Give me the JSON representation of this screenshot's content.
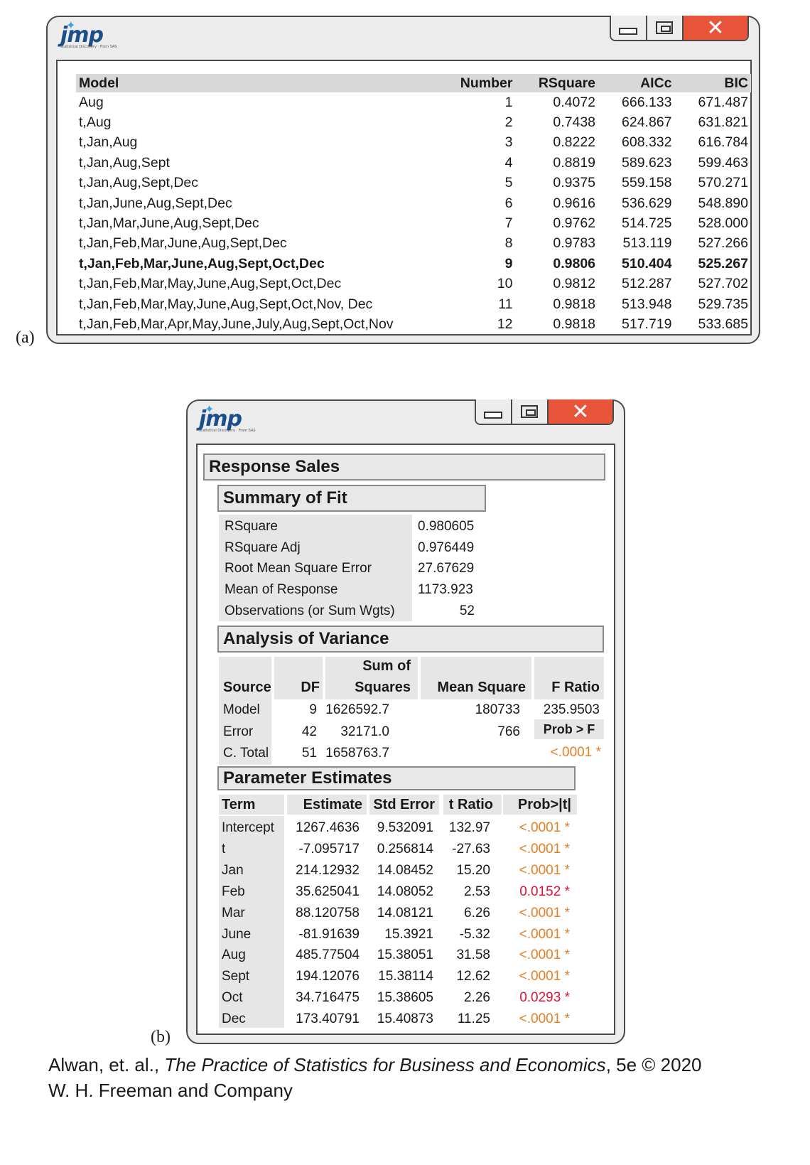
{
  "window_a": {
    "logo": "jmp",
    "caption": "(a)",
    "columns": [
      "Model",
      "Number",
      "RSquare",
      "AICc",
      "BIC"
    ],
    "rows": [
      {
        "model": "Aug",
        "number": "1",
        "rsquare": "0.4072",
        "aicc": "666.133",
        "bic": "671.487"
      },
      {
        "model": "t,Aug",
        "number": "2",
        "rsquare": "0.7438",
        "aicc": "624.867",
        "bic": "631.821"
      },
      {
        "model": "t,Jan,Aug",
        "number": "3",
        "rsquare": "0.8222",
        "aicc": "608.332",
        "bic": "616.784"
      },
      {
        "model": "t,Jan,Aug,Sept",
        "number": "4",
        "rsquare": "0.8819",
        "aicc": "589.623",
        "bic": "599.463"
      },
      {
        "model": "t,Jan,Aug,Sept,Dec",
        "number": "5",
        "rsquare": "0.9375",
        "aicc": "559.158",
        "bic": "570.271"
      },
      {
        "model": "t,Jan,June,Aug,Sept,Dec",
        "number": "6",
        "rsquare": "0.9616",
        "aicc": "536.629",
        "bic": "548.890"
      },
      {
        "model": "t,Jan,Mar,June,Aug,Sept,Dec",
        "number": "7",
        "rsquare": "0.9762",
        "aicc": "514.725",
        "bic": "528.000"
      },
      {
        "model": "t,Jan,Feb,Mar,June,Aug,Sept,Dec",
        "number": "8",
        "rsquare": "0.9783",
        "aicc": "513.119",
        "bic": "527.266"
      },
      {
        "model": "t,Jan,Feb,Mar,June,Aug,Sept,Oct,Dec",
        "number": "9",
        "rsquare": "0.9806",
        "aicc": "510.404",
        "bic": "525.267",
        "highlight": true
      },
      {
        "model": "t,Jan,Feb,Mar,May,June,Aug,Sept,Oct,Dec",
        "number": "10",
        "rsquare": "0.9812",
        "aicc": "512.287",
        "bic": "527.702"
      },
      {
        "model": "t,Jan,Feb,Mar,May,June,Aug,Sept,Oct,Nov, Dec",
        "number": "11",
        "rsquare": "0.9818",
        "aicc": "513.948",
        "bic": "529.735"
      },
      {
        "model": "t,Jan,Feb,Mar,Apr,May,June,July,Aug,Sept,Oct,Nov",
        "number": "12",
        "rsquare": "0.9818",
        "aicc": "517.719",
        "bic": "533.685"
      }
    ]
  },
  "window_b": {
    "logo": "jmp",
    "caption": "(b)",
    "response_title": "Response Sales",
    "summary": {
      "title": "Summary of Fit",
      "rows": [
        {
          "label": "RSquare",
          "value": "0.980605"
        },
        {
          "label": "RSquare Adj",
          "value": "0.976449"
        },
        {
          "label": "Root Mean Square Error",
          "value": "27.67629"
        },
        {
          "label": "Mean of Response",
          "value": "1173.923"
        },
        {
          "label": "Observations (or Sum Wgts)",
          "value": "52"
        }
      ]
    },
    "anova": {
      "title": "Analysis of Variance",
      "headers": {
        "source": "Source",
        "df": "DF",
        "ss_top": "Sum of",
        "ss_bottom": "Squares",
        "ms": "Mean Square",
        "f": "F Ratio",
        "prob": "Prob > F"
      },
      "rows": [
        {
          "source": "Model",
          "df": "9",
          "ss": "1626592.7",
          "ms": "180733",
          "f": "235.9503"
        },
        {
          "source": "Error",
          "df": "42",
          "ss": "32171.0",
          "ms": "766",
          "f": ""
        },
        {
          "source": "C. Total",
          "df": "51",
          "ss": "1658763.7",
          "ms": "",
          "f": ""
        }
      ],
      "prob_value": "<.0001 *"
    },
    "params": {
      "title": "Parameter Estimates",
      "headers": {
        "term": "Term",
        "estimate": "Estimate",
        "stderr": "Std Error",
        "tratio": "t Ratio",
        "prob": "Prob>|t|"
      },
      "rows": [
        {
          "term": "Intercept",
          "estimate": "1267.4636",
          "stderr": "9.532091",
          "tratio": "132.97",
          "prob": "<.0001 *",
          "sig": "orange"
        },
        {
          "term": "t",
          "estimate": "-7.095717",
          "stderr": "0.256814",
          "tratio": "-27.63",
          "prob": "<.0001 *",
          "sig": "orange"
        },
        {
          "term": "Jan",
          "estimate": "214.12932",
          "stderr": "14.08452",
          "tratio": "15.20",
          "prob": "<.0001 *",
          "sig": "orange"
        },
        {
          "term": "Feb",
          "estimate": "35.625041",
          "stderr": "14.08052",
          "tratio": "2.53",
          "prob": "0.0152 *",
          "sig": "red"
        },
        {
          "term": "Mar",
          "estimate": "88.120758",
          "stderr": "14.08121",
          "tratio": "6.26",
          "prob": "<.0001 *",
          "sig": "orange"
        },
        {
          "term": "June",
          "estimate": "-81.91639",
          "stderr": "15.3921",
          "tratio": "-5.32",
          "prob": "<.0001 *",
          "sig": "orange"
        },
        {
          "term": "Aug",
          "estimate": "485.77504",
          "stderr": "15.38051",
          "tratio": "31.58",
          "prob": "<.0001 *",
          "sig": "orange"
        },
        {
          "term": "Sept",
          "estimate": "194.12076",
          "stderr": "15.38114",
          "tratio": "12.62",
          "prob": "<.0001 *",
          "sig": "orange"
        },
        {
          "term": "Oct",
          "estimate": "34.716475",
          "stderr": "15.38605",
          "tratio": "2.26",
          "prob": "0.0293 *",
          "sig": "red"
        },
        {
          "term": "Dec",
          "estimate": "173.40791",
          "stderr": "15.40873",
          "tratio": "11.25",
          "prob": "<.0001 *",
          "sig": "orange"
        }
      ]
    }
  },
  "footer": {
    "line1_prefix": "Alwan, et. al., ",
    "line1_title": "The Practice of Statistics for Business and Economics",
    "line1_suffix": ", 5e © 2020",
    "line2": "W. H. Freeman and Company"
  },
  "colors": {
    "close_button": "#e8553b",
    "sig_orange": "#e67e22",
    "sig_red": "#e0123a"
  }
}
